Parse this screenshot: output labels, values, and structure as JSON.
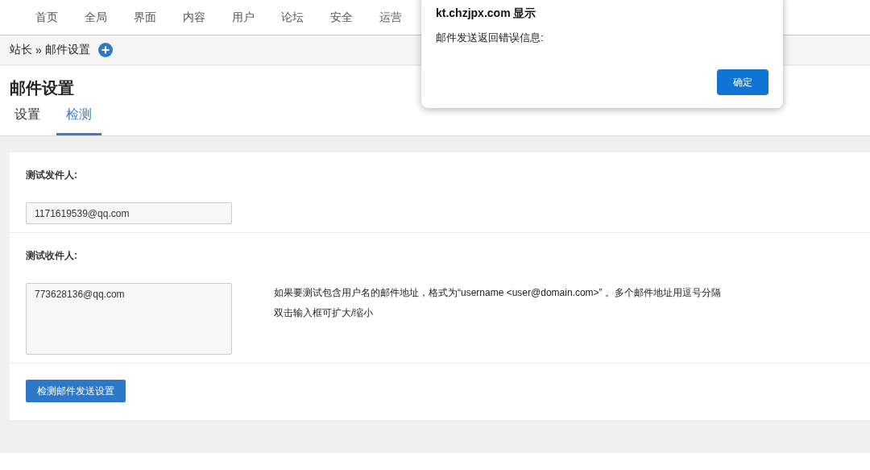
{
  "nav": [
    {
      "label": "首页"
    },
    {
      "label": "全局"
    },
    {
      "label": "界面"
    },
    {
      "label": "内容"
    },
    {
      "label": "用户"
    },
    {
      "label": "论坛"
    },
    {
      "label": "安全"
    },
    {
      "label": "运营"
    }
  ],
  "breadcrumb": {
    "root": "站长",
    "separator": "»",
    "current": "邮件设置"
  },
  "page_title": "邮件设置",
  "tabs": [
    {
      "label": "设置",
      "selected": false
    },
    {
      "label": "检测",
      "selected": true
    }
  ],
  "form": {
    "sender": {
      "label": "测试发件人:",
      "value": "1171619539@qq.com"
    },
    "recipient": {
      "label": "测试收件人:",
      "value": "773628136@qq.com",
      "hints": [
        "如果要测试包含用户名的邮件地址，格式为“username <user@domain.com>” 。多个邮件地址用逗号分隔",
        "双击输入框可扩大/缩小"
      ]
    },
    "submit": "检测邮件发送设置"
  },
  "dialog": {
    "title": "kt.chzjpx.com 显示",
    "message": "邮件发送返回错误信息:",
    "ok": "确定"
  }
}
